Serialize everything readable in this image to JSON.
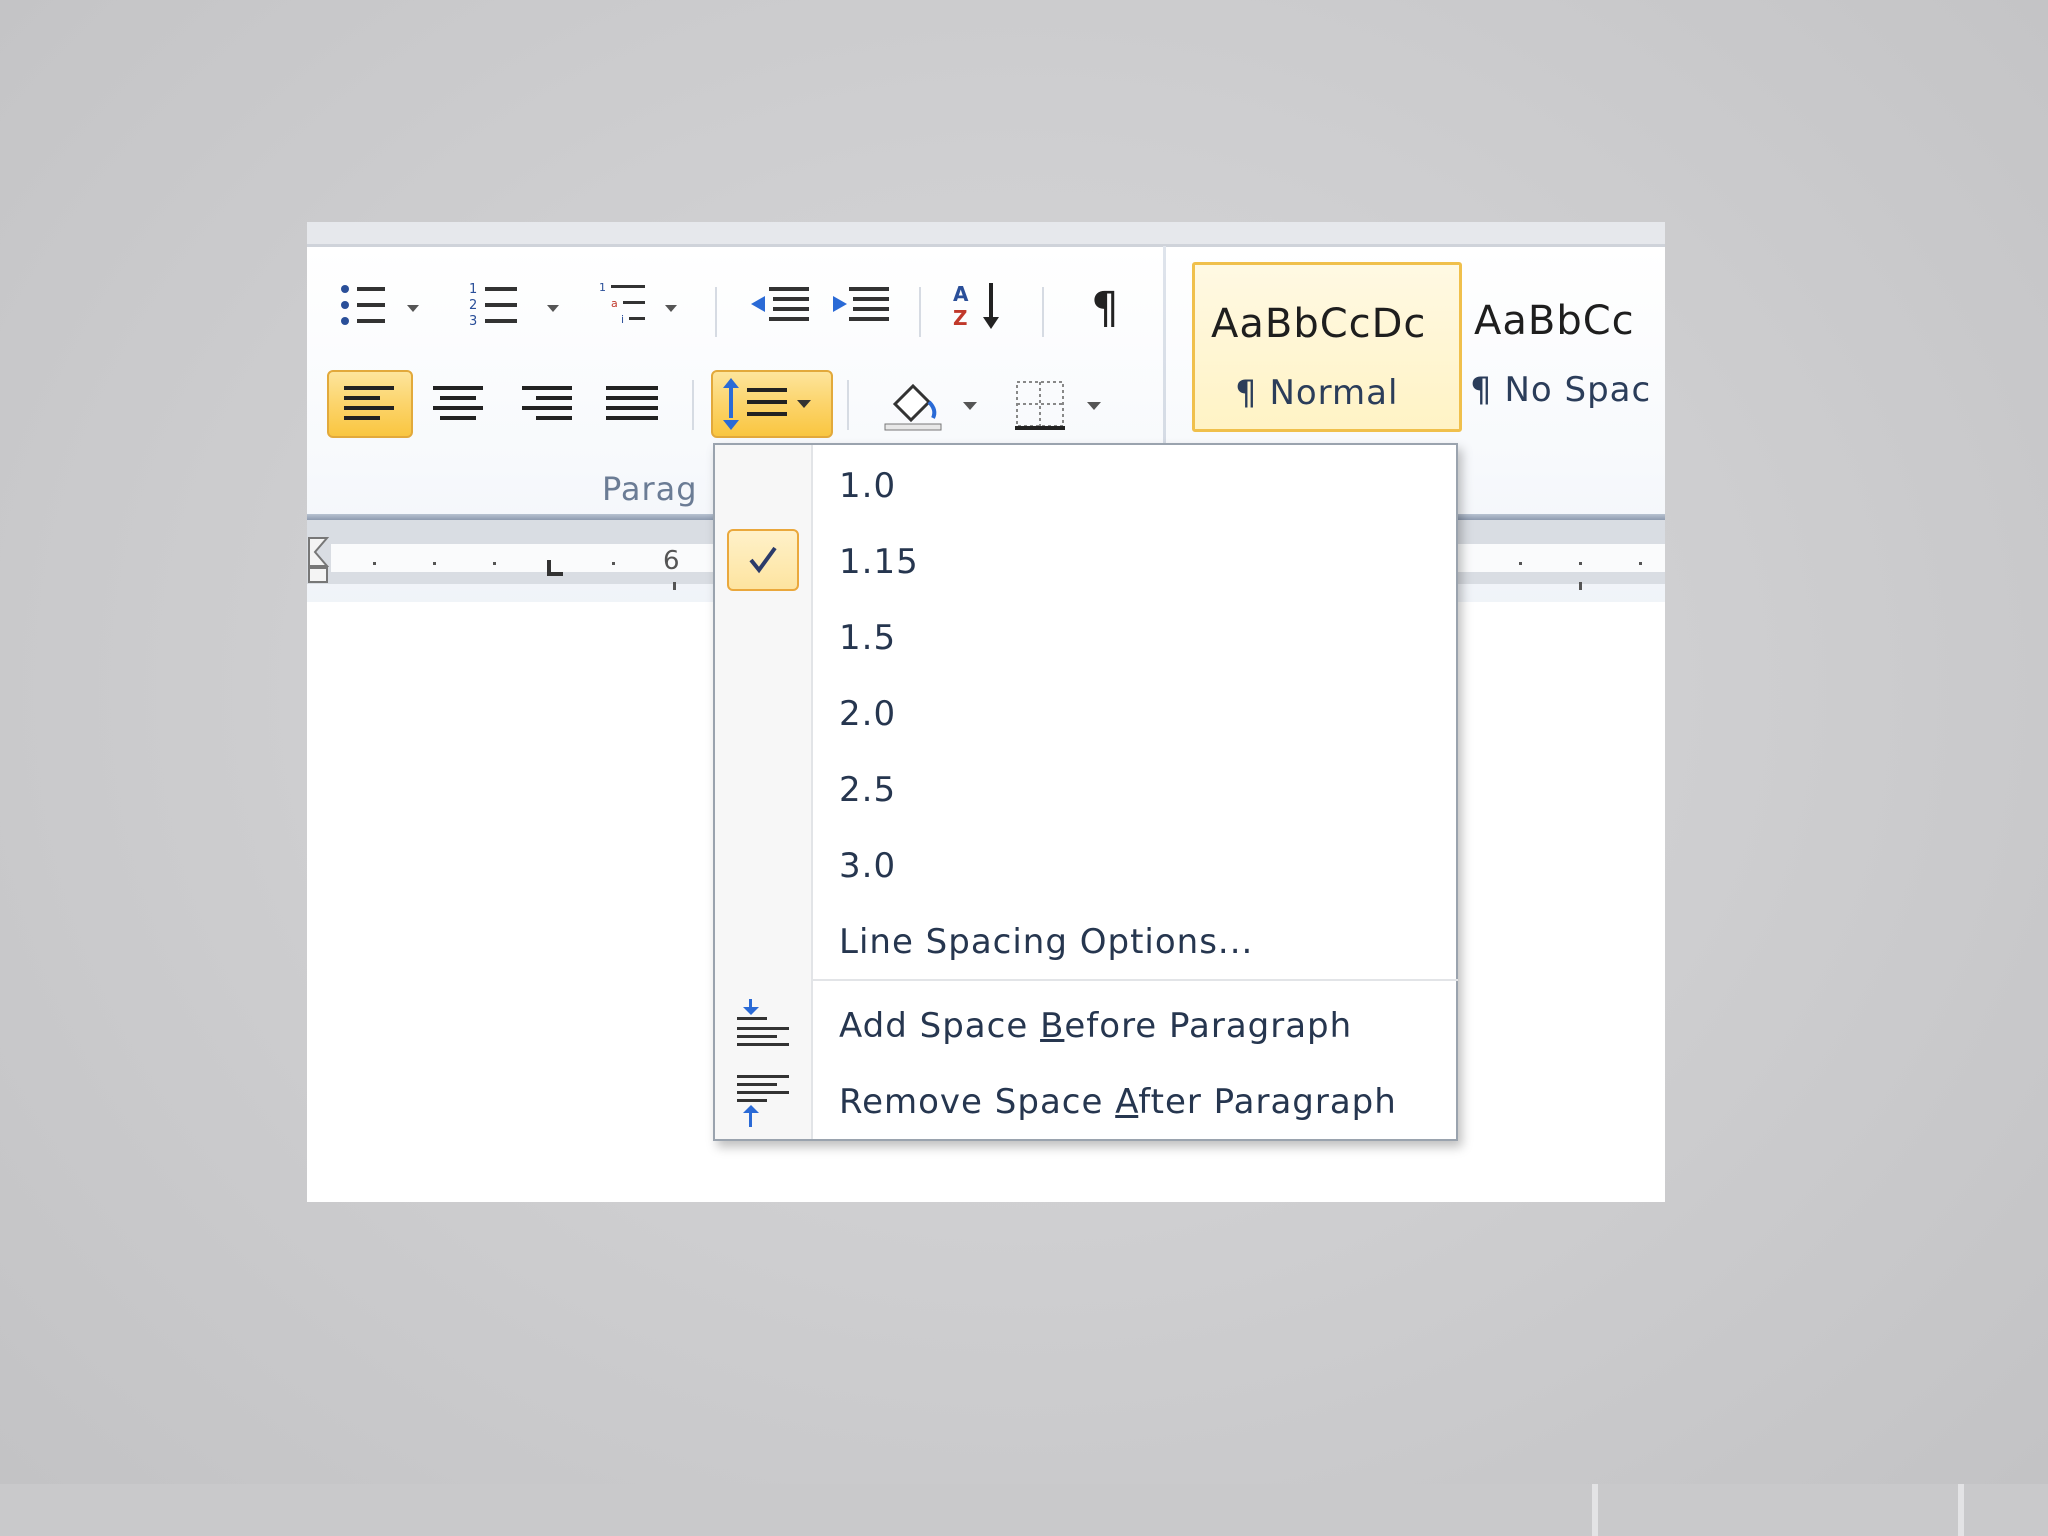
{
  "ribbon": {
    "group_label": "Parag",
    "ruler_number": "6",
    "buttons": {
      "bullets": "bullets-icon",
      "numbering": "numbering-icon",
      "multilevel": "multilevel-list-icon",
      "decrease_indent": "decrease-indent-icon",
      "increase_indent": "increase-indent-icon",
      "sort": "sort-az-icon",
      "show_marks": "pilcrow-icon",
      "align_left": "align-left-icon",
      "align_center": "align-center-icon",
      "align_right": "align-right-icon",
      "justify": "justify-icon",
      "line_spacing": "line-spacing-icon",
      "shading": "shading-icon",
      "borders": "borders-icon"
    },
    "styles": [
      {
        "sample": "AaBbCcDc",
        "name": "¶ Normal",
        "selected": true
      },
      {
        "sample": "AaBbCc",
        "name": "¶ No Spac",
        "selected": false
      }
    ]
  },
  "line_spacing_menu": {
    "items": [
      {
        "label": "1.0",
        "checked": false
      },
      {
        "label": "1.15",
        "checked": true
      },
      {
        "label": "1.5",
        "checked": false
      },
      {
        "label": "2.0",
        "checked": false
      },
      {
        "label": "2.5",
        "checked": false
      },
      {
        "label": "3.0",
        "checked": false
      }
    ],
    "options_label": "Line Spacing Options...",
    "add_space_before": {
      "pre": "Add Space ",
      "key": "B",
      "post": "efore Paragraph"
    },
    "remove_space_after": {
      "pre": "Remove Space ",
      "key": "A",
      "post": "fter Paragraph"
    }
  },
  "colors": {
    "highlight": "#fcd46b",
    "menu_text": "#26364f",
    "check_border": "#eaa83c"
  }
}
